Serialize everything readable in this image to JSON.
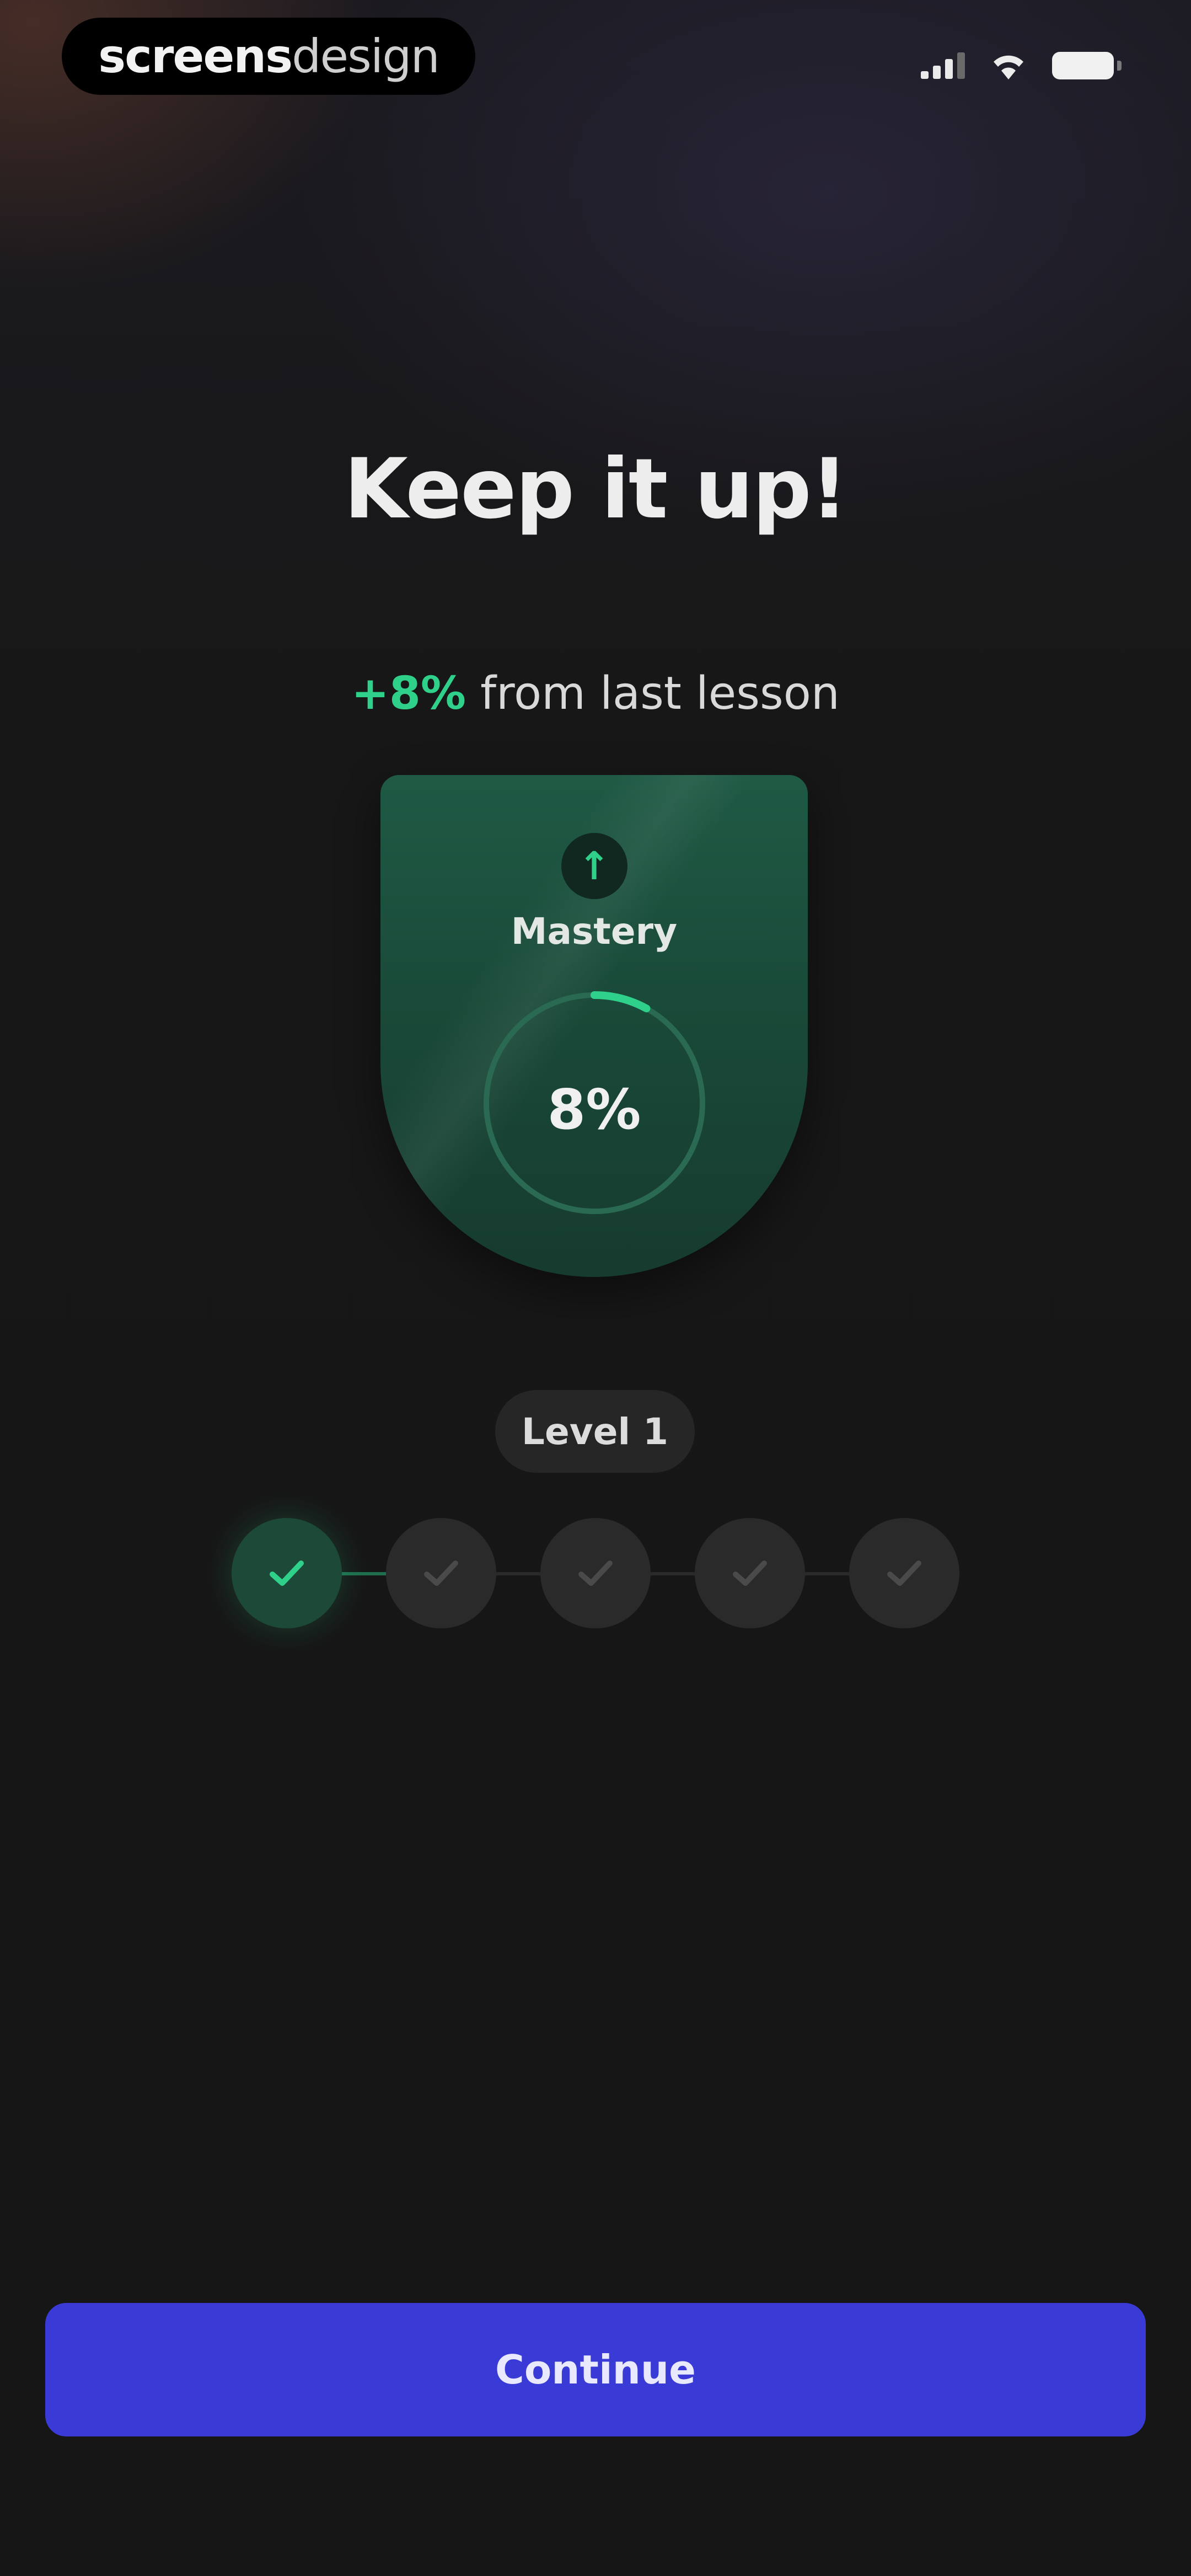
{
  "status_bar": {
    "watermark_bold": "screens",
    "watermark_light": "design",
    "signal_icon": "cellular-signal-icon",
    "wifi_icon": "wifi-icon",
    "battery_icon": "battery-icon"
  },
  "header": {
    "title": "Keep it up!",
    "gain": "+8%",
    "gain_suffix": " from last lesson"
  },
  "mastery_card": {
    "icon": "arrow-up-icon",
    "icon_glyph": "↑",
    "label": "Mastery",
    "value_text": "8%",
    "progress_percent": 8
  },
  "level": {
    "label": "Level 1",
    "steps_total": 5,
    "steps_completed": 1
  },
  "colors": {
    "accent_green": "#2fd08a",
    "button_blue": "#3a3ad6",
    "background": "#161616"
  },
  "footer": {
    "continue_label": "Continue"
  }
}
